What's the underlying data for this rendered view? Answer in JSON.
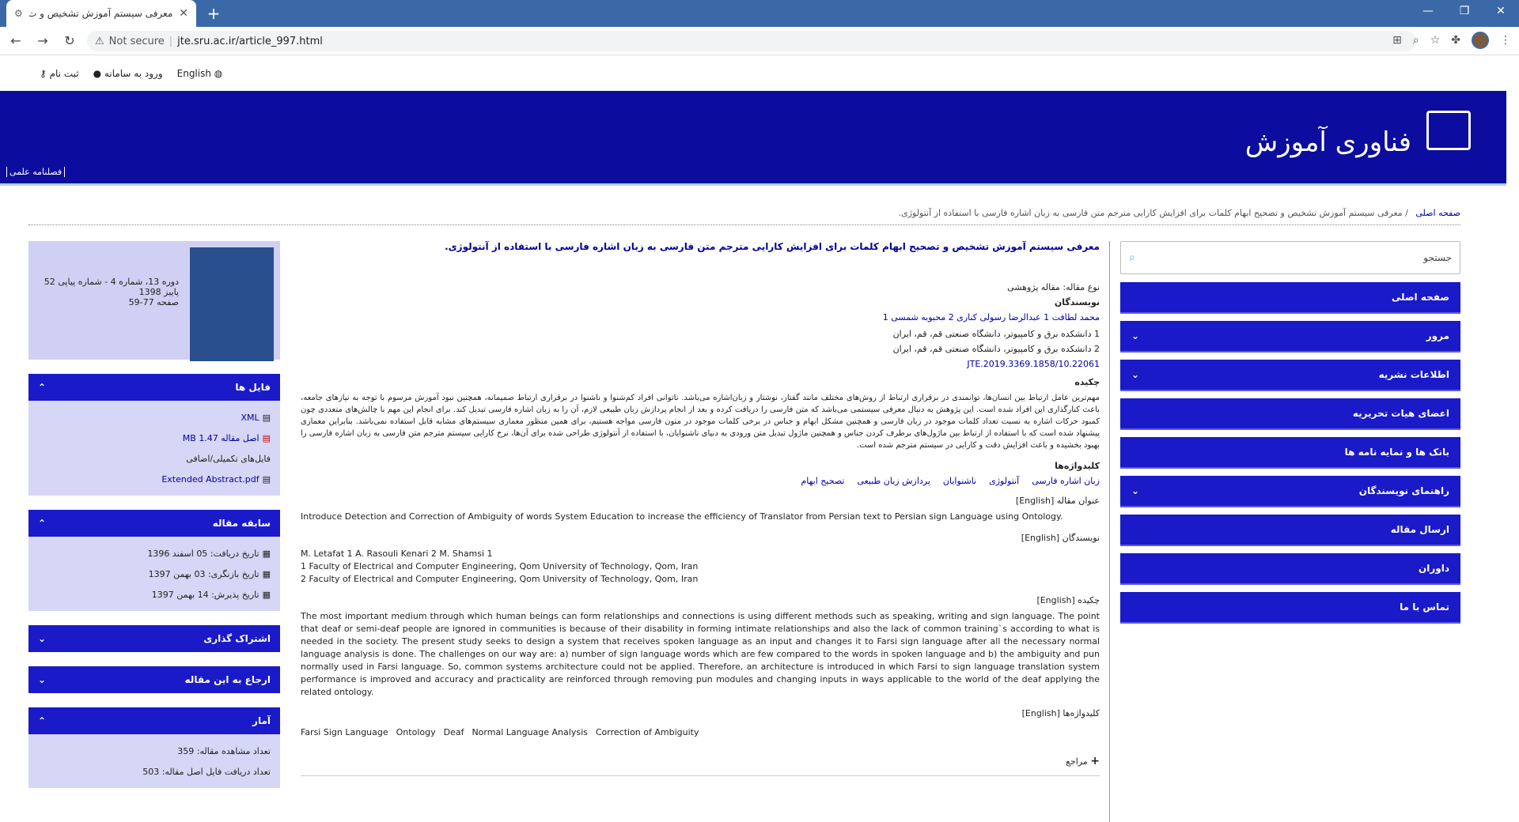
{
  "browser": {
    "tab_title": "معرفی سیستم آموزش تشخیص و ت",
    "close_glyph": "✕",
    "new_tab_glyph": "+",
    "not_secure": "Not secure",
    "url": "jte.sru.ac.ir/article_997.html"
  },
  "topbar": {
    "register": "ثبت نام",
    "login": "ورود به سامانه",
    "english": "English"
  },
  "banner": {
    "site_name": "فناوری آموزش",
    "quarterly": "فصلنامه علمی"
  },
  "breadcrumb": {
    "home": "صفحه اصلی",
    "current": "معرفی سیستم آموزش تشخیص و تصحیح ابهام کلمات برای افزایش کارایی مترجم متن فارسی به زبان اشاره فارسی با استفاده از آنتولوژی."
  },
  "sidebar": {
    "search_placeholder": "جستجو",
    "items": [
      {
        "label": "صفحه اصلی",
        "arrow": ""
      },
      {
        "label": "مرور",
        "arrow": "⌄"
      },
      {
        "label": "اطلاعات نشریه",
        "arrow": "⌄"
      },
      {
        "label": "اعضای هیات تحریریه",
        "arrow": ""
      },
      {
        "label": "بانک ها و نمایه نامه ها",
        "arrow": ""
      },
      {
        "label": "راهنمای نویسندگان",
        "arrow": "⌄"
      },
      {
        "label": "ارسال مقاله",
        "arrow": ""
      },
      {
        "label": "داوران",
        "arrow": ""
      },
      {
        "label": "تماس با ما",
        "arrow": ""
      }
    ]
  },
  "article": {
    "title": "معرفی سیستم آموزش تشخیص و تصحیح ابهام کلمات برای افزایش کارایی مترجم متن فارسی به زبان اشاره فارسی با استفاده از آنتولوژی.",
    "type": "نوع مقاله: مقاله پژوهشی",
    "authors_label": "نویسندگان",
    "authors": "محمد لطافت 1   عبدالرضا رسولی کناری 2   محبوبه شمسی 1",
    "affil1": "1 دانشکده برق و کامپیوتر، دانشگاه صنعتی قم، قم، ایران",
    "affil2": "2 دانشکده برق و کامپیوتر، دانشگاه صنعتی قم، قم، ایران",
    "doi": "10.22061/JTE.2019.3369.1858",
    "abstract_label": "چکیده",
    "abstract": "مهم‌ترین عامل ارتباط بین انسان‌ها، توانمندی در برقراری ارتباط از روش‌های مختلف مانند گفتار، نوشتار و زبان‌اشاره می‌باشد. ناتوانی افراد کم‌شنوا و ناشنوا در برقراری ارتباط صمیمانه، همچنین نبود آموزش مرسوم با توجه به نیازهای جامعه، باعث کنارگذاری این افراد شده است. این پژوهش به دنبال معرفی سیستمی می‌باشد که متن فارسی را دریافت کرده و بعد از انجام پردازش زبان طبیعی لازم، آن را به زبان اشاره فارسی تبدیل کند. برای انجام این مهم با چالش‌های متعددی چون کمبود حرکات اشاره به نسبت تعداد کلمات موجود در زبان فارسی و همچنین مشکل ابهام و جناس در برخی کلمات موجود در متون فارسی مواجه هستیم، برای همین منظور معماری سیستم‌های مشابه قابل استفاده نمی‌باشد. بنابراین معماری پیشنهاد شده است که با استفاده از ارتباط بین ماژول‌های برطرف کردن جناس و همچنین ماژول تبدیل متن ورودی به دنیای ناشنوایان، با استفاده از آنتولوژی طراحی شده برای آن‌ها، نرخ کارایی سیستم مترجم متن فارسی به زبان اشاره فارسی را بهبود بخشیده و باعث افزایش دقت و کارایی در سیستم مترجم شده است.",
    "keywords_label": "کلیدواژه‌ها",
    "keywords": [
      "زبان اشاره فارسی",
      "آنتولوژی",
      "ناشنوایان",
      "پردازش زبان طبیعی",
      "تصحیح ابهام"
    ],
    "en_title_label": "عنوان مقاله [English]",
    "en_title": "Introduce Detection and Correction of Ambiguity of words System Education to increase the efficiency of Translator from Persian text to Persian sign Language using Ontology.",
    "en_authors_label": "نویسندگان [English]",
    "en_authors": "M. Letafat 1    A. Rasouli Kenari 2    M. Shamsi 1",
    "en_affil1": "1 Faculty of Electrical and Computer Engineering, Qom University of Technology, Qom, Iran",
    "en_affil2": "2 Faculty of Electrical and Computer Engineering, Qom University of Technology, Qom, Iran",
    "en_abstract_label": "چکیده [English]",
    "en_abstract": "The most important medium through which human beings can form relationships and connections is using different methods such as speaking, writing and sign language. The point that deaf or semi-deaf people are ignored in communities is because of their disability in forming intimate relationships and also the lack of common training`s according to what is needed in the society. The present study seeks to design a system that receives spoken language as an input and changes it to Farsi sign language after all the necessary normal language analysis is done. The challenges on our way are: a) number of sign language words which are few compared to the words in spoken language and b) the ambiguity and pun normally used in Farsi language. So, common systems architecture could not be applied. Therefore, an architecture is introduced in which Farsi to sign language translation system performance is improved and accuracy and practicality are reinforced through removing pun modules and changing inputs in ways applicable to the world of the deaf applying the related ontology.",
    "en_keywords_label": "کلیدواژه‌ها [English]",
    "en_keywords": [
      "Farsi Sign Language",
      "Ontology",
      "Deaf",
      "Normal Language Analysis",
      "Correction of Ambiguity"
    ],
    "references": "مراجع"
  },
  "issue": {
    "line1": "دوره 13، شماره 4 - شماره پیاپی 52",
    "line2": "پاییز 1398",
    "line3": "صفحه 77-59"
  },
  "panels": {
    "files": {
      "title": "فایل ها",
      "xml": "XML",
      "pdf": "اصل مقاله 1.47 MB",
      "extra": "فایل‌های تکمیلی/اضافی",
      "extended": "Extended Abstract.pdf"
    },
    "history": {
      "title": "سابقه مقاله",
      "received": "تاریخ دریافت: 05 اسفند 1396",
      "revised": "تاریخ بازنگری: 03 بهمن 1397",
      "accepted": "تاریخ پذیرش: 14 بهمن 1397"
    },
    "share": {
      "title": "اشتراک گذاری"
    },
    "cite": {
      "title": "ارجاع به این مقاله"
    },
    "stats": {
      "title": "آمار",
      "views": "تعداد مشاهده مقاله: 359",
      "downloads": "تعداد دریافت فایل اصل مقاله: 503"
    }
  }
}
